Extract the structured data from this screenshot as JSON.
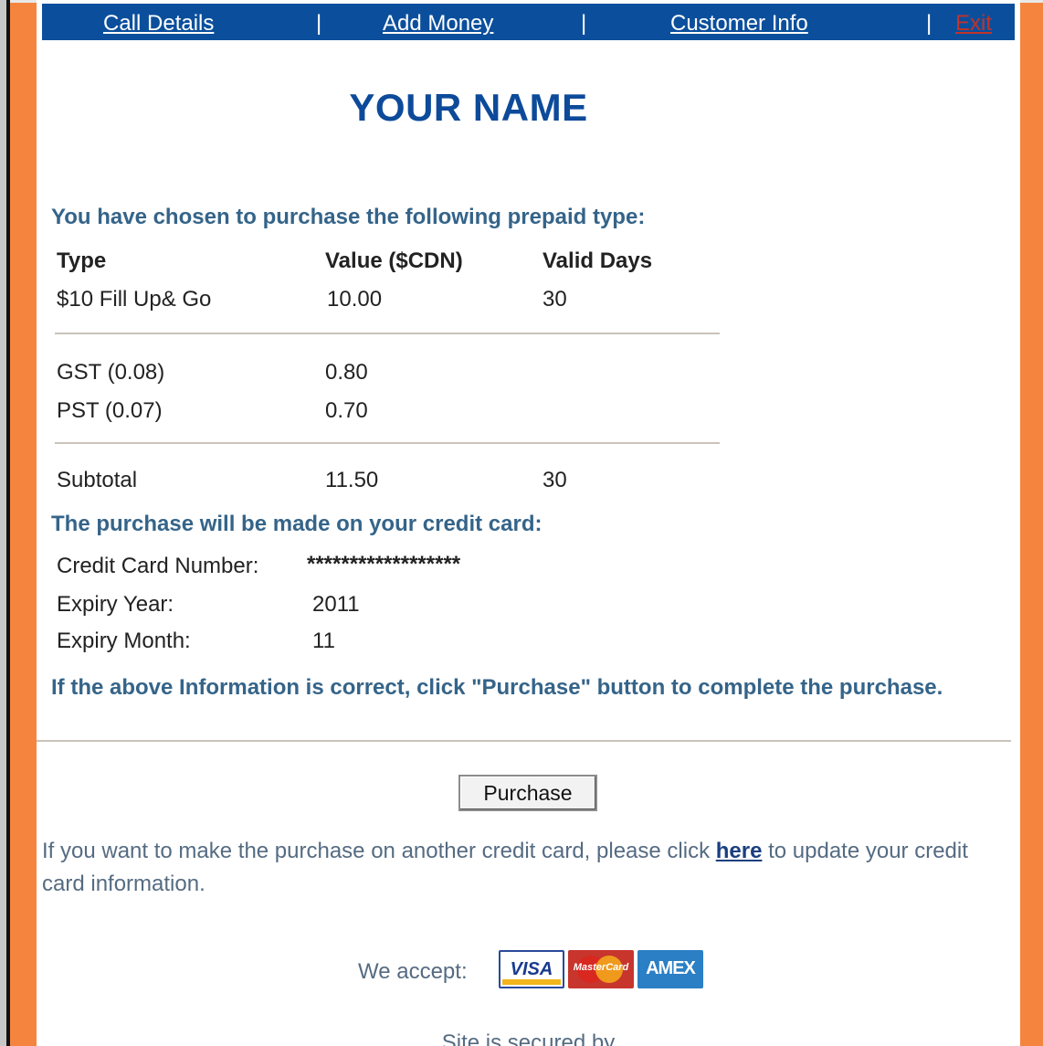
{
  "nav": {
    "items": [
      "Call Details",
      "Add Money",
      "Customer Info",
      "Exit"
    ],
    "separator": "|"
  },
  "site_title": "YOUR NAME",
  "prepaid": {
    "heading": "You have chosen to purchase the following prepaid type:",
    "headers": [
      "Type",
      "Value ($CDN)",
      "Valid Days"
    ],
    "item": {
      "type": "$10 Fill Up& Go",
      "value": "10.00",
      "days": "30"
    },
    "taxes": [
      {
        "label": "GST (0.08)",
        "value": "0.80"
      },
      {
        "label": "PST (0.07)",
        "value": "0.70"
      }
    ],
    "subtotal": {
      "label": "Subtotal",
      "value": "11.50",
      "days": "30"
    }
  },
  "card": {
    "heading": "The purchase will be made on your credit card:",
    "number_label": "Credit Card Number:",
    "number_value": "******************",
    "year_label": "Expiry Year:",
    "year_value": "2011",
    "month_label": "Expiry Month:",
    "month_value": "11"
  },
  "confirm_message": "If the above Information is correct, click \"Purchase\" button to complete the purchase.",
  "purchase_button": "Purchase",
  "info": {
    "before": "If you want to make the purchase on another credit card, please click ",
    "link": "here",
    "after": " to update your credit card information."
  },
  "accept": {
    "label": "We accept:",
    "cards": [
      "VISA",
      "MasterCard",
      "AMEX"
    ]
  },
  "secured_text": "Site is secured by",
  "colors": {
    "nav_bg": "#0b4f9c",
    "frame_orange": "#f5843f",
    "title_blue": "#0d4a9a",
    "heading_blue": "#356489"
  }
}
